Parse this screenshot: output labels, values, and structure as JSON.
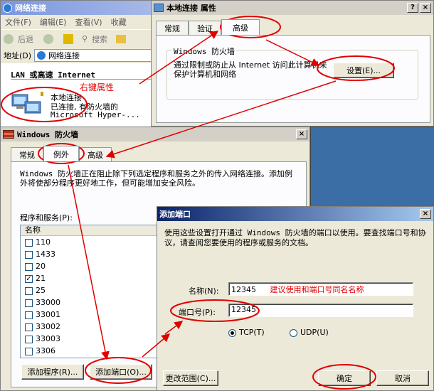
{
  "explorer": {
    "title": "网络连接",
    "menu": [
      "文件(F)",
      "编辑(E)",
      "查看(V)",
      "收藏"
    ],
    "toolbar": {
      "back": "后退",
      "search": "搜索"
    },
    "address_label": "地址(D)",
    "address_value": "网络连接",
    "section_header": "LAN 或高速 Internet",
    "conn_name": "本地连接",
    "conn_status": "已连接, 有防火墙的",
    "conn_device": "Microsoft Hyper-..."
  },
  "annotation_right_click": "右键属性",
  "props": {
    "title": "本地连接 属性",
    "help": "?",
    "close": "×",
    "tabs": [
      "常规",
      "验证",
      "高级"
    ],
    "group_label": "Windows 防火墙",
    "desc": "通过限制或防止从 Internet 访问此计算机来保护计算机和网络",
    "settings_button": "设置(E)..."
  },
  "firewall": {
    "title": "Windows 防火墙",
    "close": "×",
    "tabs": [
      "常规",
      "例外",
      "高级"
    ],
    "desc": "Windows 防火墙正在阻止除下列选定程序和服务之外的传入网络连接。添加例外将使部分程序更好地工作，但可能增加安全风险。",
    "list_label": "程序和服务(P):",
    "list_header": "名称",
    "items": [
      {
        "name": "110",
        "checked": false
      },
      {
        "name": "1433",
        "checked": false
      },
      {
        "name": "20",
        "checked": false
      },
      {
        "name": "21",
        "checked": true
      },
      {
        "name": "25",
        "checked": false
      },
      {
        "name": "33000",
        "checked": false
      },
      {
        "name": "33001",
        "checked": false
      },
      {
        "name": "33002",
        "checked": false
      },
      {
        "name": "33003",
        "checked": false
      },
      {
        "name": "3306",
        "checked": false
      }
    ],
    "add_program": "添加程序(R)...",
    "add_port": "添加端口(O)..."
  },
  "addport": {
    "title": "添加端口",
    "close": "×",
    "desc": "使用这些设置打开通过 Windows 防火墙的端口以使用。要查找端口号和协议，请查阅您要使用的程序或服务的文档。",
    "name_label": "名称(N):",
    "name_value": "12345",
    "name_hint": "建议使用和端口号同名名称",
    "port_label": "端口号(P):",
    "port_value": "12345",
    "tcp": "TCP(T)",
    "udp": "UDP(U)",
    "scope": "更改范围(C)...",
    "ok": "确定",
    "cancel": "取消"
  },
  "colors": {
    "annotation": "#e00000",
    "titlebar_active": "#0a246a"
  }
}
